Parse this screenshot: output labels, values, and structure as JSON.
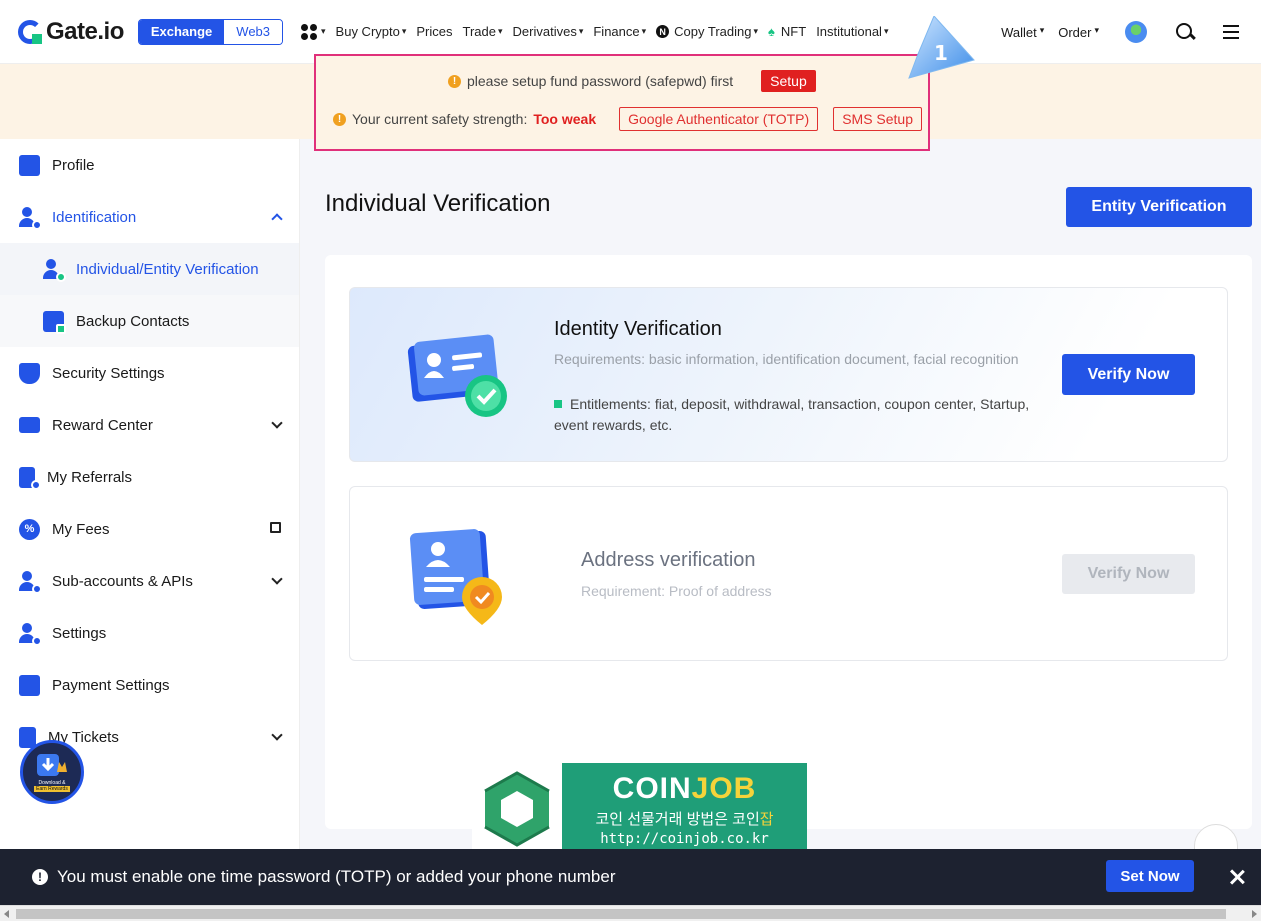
{
  "header": {
    "logo_text": "Gate.io",
    "seg_exchange": "Exchange",
    "seg_web3": "Web3",
    "nav": [
      "Buy Crypto",
      "Prices",
      "Trade",
      "Derivatives",
      "Finance",
      "Copy Trading",
      "NFT",
      "Institutional"
    ],
    "nav_caret": [
      "▾",
      "",
      "▾",
      "▾",
      "▾",
      "▾",
      "",
      "▾"
    ],
    "wallet": "Wallet",
    "order": "Order",
    "caret": "▾"
  },
  "annotation": {
    "number": "1"
  },
  "warning": {
    "line1": "please setup fund password (safepwd) first",
    "setup_btn": "Setup",
    "line2_prefix": "Your current safety strength:",
    "strength": "Too weak",
    "google_btn": "Google Authenticator (TOTP)",
    "sms_btn": "SMS Setup"
  },
  "sidebar": {
    "items": [
      {
        "label": "Profile"
      },
      {
        "label": "Identification"
      },
      {
        "label": "Individual/Entity Verification"
      },
      {
        "label": "Backup Contacts"
      },
      {
        "label": "Security Settings"
      },
      {
        "label": "Reward Center"
      },
      {
        "label": "My Referrals"
      },
      {
        "label": "My Fees"
      },
      {
        "label": "Sub-accounts & APIs"
      },
      {
        "label": "Settings"
      },
      {
        "label": "Payment Settings"
      },
      {
        "label": "My Tickets"
      }
    ],
    "badge_line1": "Download &",
    "badge_line2": "Earn Rewards"
  },
  "main": {
    "title": "Individual Verification",
    "entity_btn": "Entity Verification",
    "identity": {
      "title": "Identity Verification",
      "requirements": "Requirements: basic information, identification document, facial recognition",
      "entitlements": "Entitlements: fiat, deposit, withdrawal, transaction, coupon center, Startup, event rewards, etc.",
      "button": "Verify Now"
    },
    "address": {
      "title": "Address verification",
      "requirements": "Requirement: Proof of address",
      "button": "Verify Now"
    }
  },
  "ad": {
    "brand_a": "COIN",
    "brand_b": "JOB",
    "sub_a": "코인 선물거래 방법은 코인",
    "sub_b": "잡",
    "url": "http://coinjob.co.kr"
  },
  "bottom": {
    "message": "You must enable one time password (TOTP) or added your phone number",
    "button": "Set Now"
  },
  "colors": {
    "accent": "#2354e6",
    "success": "#18c584",
    "danger": "#e02020",
    "annotation": "#e0307a"
  }
}
